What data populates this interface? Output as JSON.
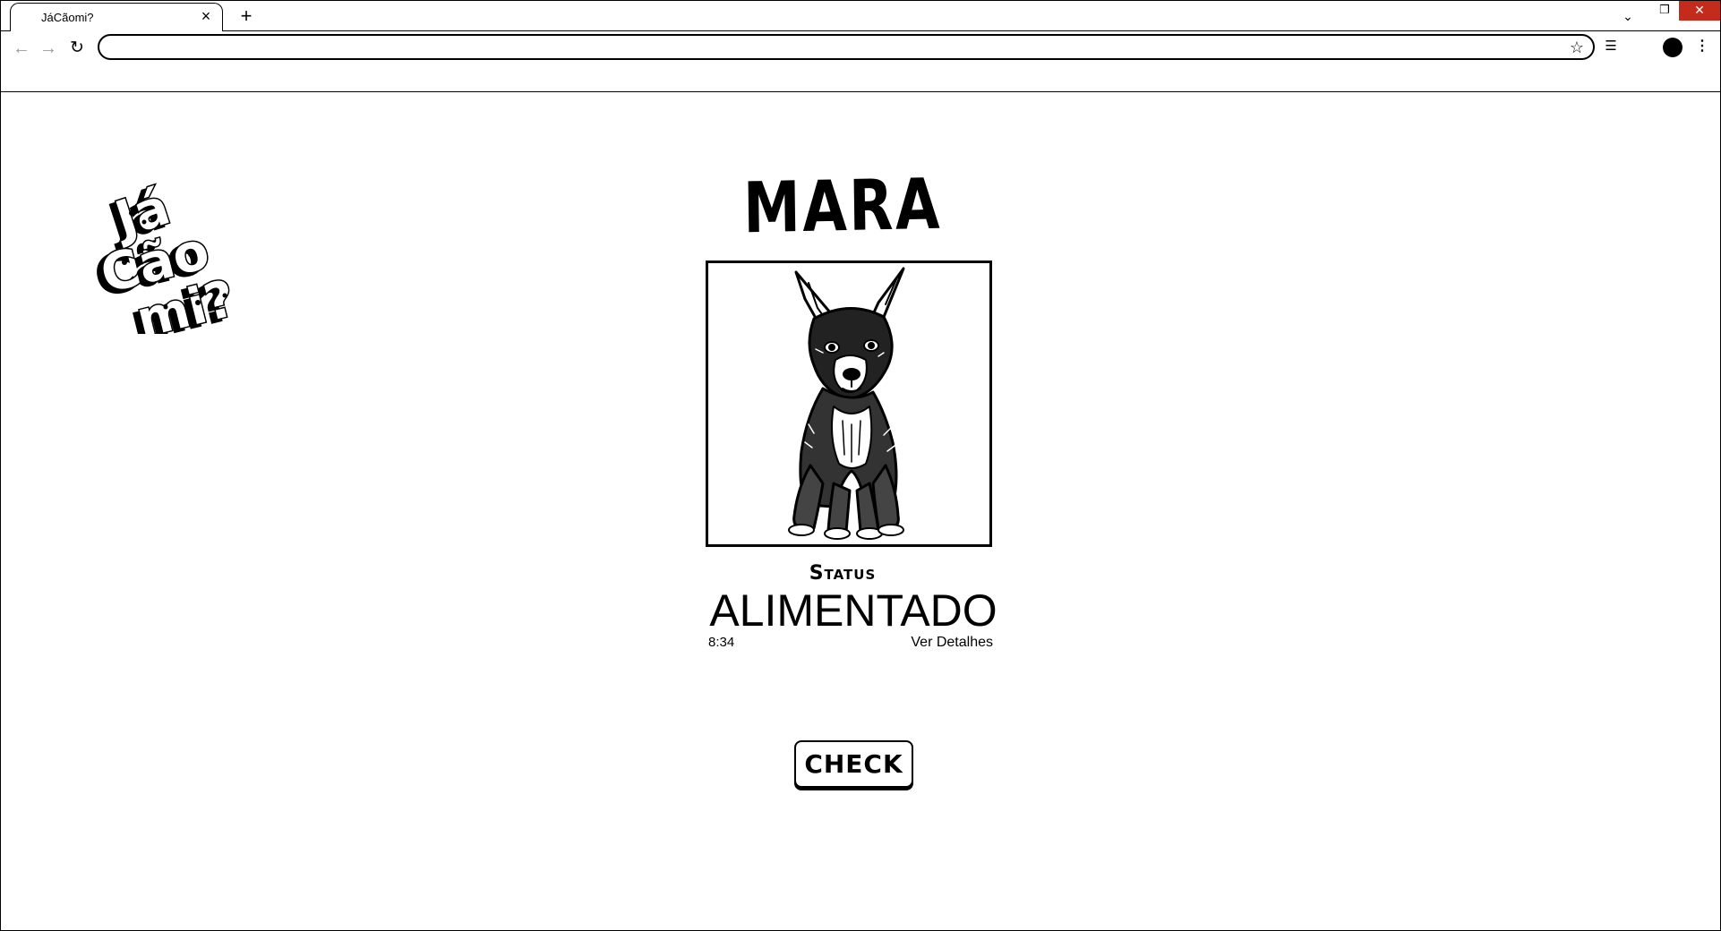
{
  "browser": {
    "tab_title": "JáCãomi?",
    "tab_close": "×",
    "new_tab": "+",
    "tab_search": "⌄",
    "restore": "❐",
    "close": "✕",
    "back": "←",
    "forward": "→",
    "reload": "↻",
    "address_value": "",
    "bookmark": "☆",
    "reading_list": "☰",
    "menu": "⋮"
  },
  "page": {
    "logo_text": "Já Cão mi?",
    "pet_name": "MARA",
    "status_label": "Status",
    "status_value": "ALIMENTADO",
    "time": "8:34",
    "details_link": "Ver Detalhes",
    "check_button": "CHECK"
  },
  "icons": {
    "logo": "jacaomi-logo-icon",
    "pet_photo": "dog-illustration-icon"
  },
  "colors": {
    "close_button": "#c42b1c",
    "foreground": "#000000",
    "background": "#ffffff"
  }
}
